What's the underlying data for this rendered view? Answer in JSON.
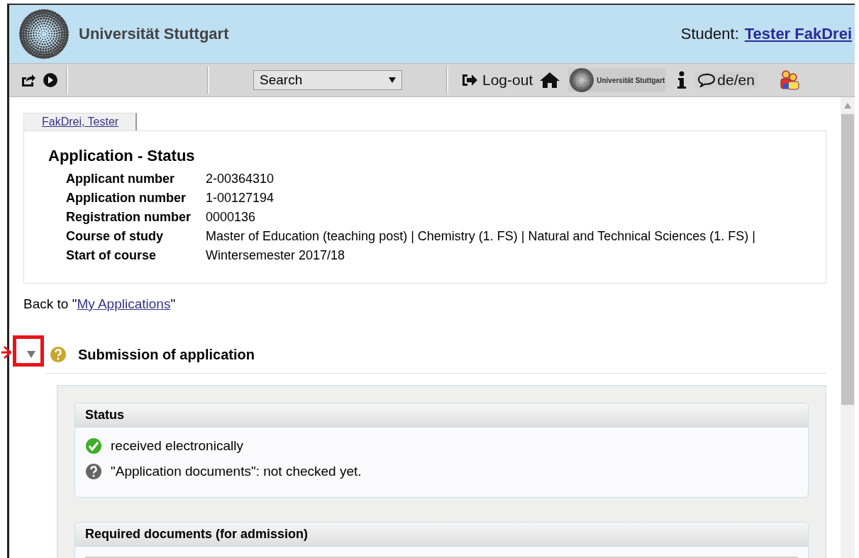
{
  "header": {
    "university": "Universität Stuttgart",
    "student_label": "Student:",
    "student_name": "Tester FakDrei"
  },
  "toolbar": {
    "search": {
      "value": "Search"
    },
    "logout": "Log-out",
    "mini_logo": "Universität Stuttgart",
    "language": "de/en"
  },
  "tab": {
    "label": "FakDrei, Tester"
  },
  "summary": {
    "title": "Application - Status",
    "rows": [
      {
        "label": "Applicant number",
        "value": "2-00364310"
      },
      {
        "label": "Application number",
        "value": "1-00127194"
      },
      {
        "label": "Registration number",
        "value": "0000136"
      },
      {
        "label": "Course of study",
        "value": "Master of Education (teaching post) | Chemistry (1. FS) | Natural and Technical Sciences (1. FS) |"
      },
      {
        "label": "Start of course",
        "value": "Wintersemester 2017/18"
      }
    ]
  },
  "back_link": {
    "before": "Back to \"",
    "link": "My Applications",
    "after": "\""
  },
  "section": {
    "title": "Submission of application",
    "expanded": true,
    "panels": [
      {
        "title": "Status",
        "items": [
          {
            "kind": "ok",
            "text": "received electronically"
          },
          {
            "kind": "pending",
            "text": "\"Application documents\": not checked yet."
          }
        ]
      },
      {
        "title": "Required documents (for admission)"
      }
    ]
  }
}
